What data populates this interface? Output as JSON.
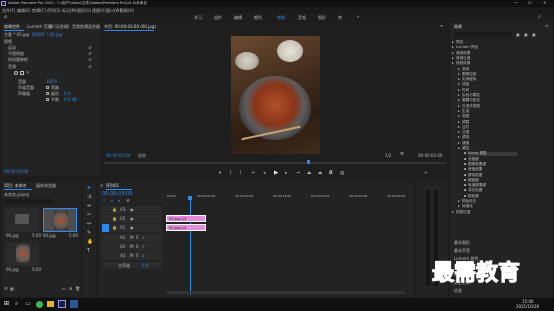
{
  "window": {
    "title": "Adobe Premiere Pro 2020 - C:\\用户\\Video\\文件\\Adobe\\Premiere Pro\\14.0\\未命名",
    "menu": [
      "文件(F)",
      "编辑(E)",
      "剪辑(C)",
      "序列(S)",
      "标记(M)",
      "图形(G)",
      "视图(V)",
      "窗口(W)",
      "帮助(H)"
    ]
  },
  "workspaces": [
    "学习",
    "组件",
    "编辑",
    "颜色",
    "效果",
    "音频",
    "图形",
    "库"
  ],
  "effect_controls": {
    "tabs": [
      "效果控件",
      "Lumetri 范围",
      "源:(无剪辑)",
      "音频剪辑混合器"
    ],
    "source_row": "主要 * 00.jpg",
    "clip_row": "序列01 * 00.jpg",
    "section_video": "视频",
    "rows": [
      "运动",
      "不透明度",
      "时间重映射"
    ],
    "section_audio": "音频",
    "audio_rows": [
      "音量",
      "声道音量",
      "声像器"
    ],
    "values": [
      "100.0",
      "0.0",
      "0.0 dB"
    ],
    "sub_labels": [
      "旁路",
      "级别",
      "平衡"
    ],
    "timecode": "00:00:03:00"
  },
  "program": {
    "title": "节目: 00:00:03:00 (00.jpg)",
    "timecode_left": "00:00:03:00",
    "fit": "适合",
    "quality": "1/2",
    "timecode_right": "00:00:03:00"
  },
  "project": {
    "tabs": [
      "项目: 未命名",
      "媒体浏览器"
    ],
    "file": "未命名.prproj",
    "items": [
      {
        "name": "00.jpg",
        "duration": "5:00"
      },
      {
        "name": "00.jpg",
        "duration": "5:00"
      },
      {
        "name": "00.jpg",
        "duration": "5:00"
      }
    ]
  },
  "timeline": {
    "title": "序列01",
    "timecode": "00:00:03:00",
    "ruler": [
      "00:00",
      "00:00:05:00",
      "00:00:10:00",
      "00:00:15:00",
      "00:00:20:00",
      "00:00:25:00",
      "00:00:30:00"
    ],
    "video_tracks": [
      "V3",
      "V2",
      "V1"
    ],
    "audio_tracks": [
      "A1",
      "A2",
      "A3"
    ],
    "master": "主声道",
    "master_value": "0.0",
    "clips": [
      "00.jpg [V]",
      "00.jpg [V]"
    ]
  },
  "effects_panel": {
    "title": "效果",
    "folders": [
      "预设",
      "Lumetri 预设",
      "音频效果",
      "音频过渡",
      "视频效果",
      "变换",
      "图像控制",
      "实用程序",
      "扭曲",
      "时间",
      "杂色与颗粒",
      "模糊与锐化",
      "沉浸式视频",
      "生成",
      "视频",
      "调整",
      "过时",
      "过渡",
      "透视",
      "通道",
      "键控"
    ],
    "subitems": [
      "Alpha 调整",
      "亮度键",
      "图像遮罩键",
      "差值遮罩",
      "移除遮罩",
      "超级键",
      "轨道遮罩键",
      "非红色键",
      "颜色键"
    ],
    "extra": [
      "颜色校正",
      "风格化",
      "视频过渡"
    ],
    "bottom": [
      "基本图形",
      "基本声音",
      "Lumetri 颜色",
      "库",
      "标记",
      "历史记录",
      "信息"
    ]
  },
  "taskbar": {
    "time": "15:00",
    "date": "2021/10/26"
  },
  "watermark": "最需教育",
  "colors": {
    "accent": "#2d8ceb",
    "clip": "#e58ee0"
  }
}
